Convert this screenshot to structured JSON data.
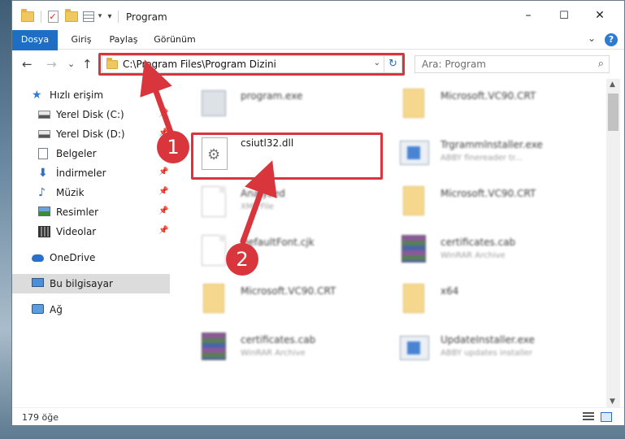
{
  "window": {
    "title": "Program",
    "controls": {
      "minimize": "–",
      "maximize": "☐",
      "close": "✕"
    }
  },
  "ribbon": {
    "tabs": [
      {
        "label": "Dosya",
        "active": true
      },
      {
        "label": "Giriş"
      },
      {
        "label": "Paylaş"
      },
      {
        "label": "Görünüm"
      }
    ],
    "expand_glyph": "⌄",
    "help_glyph": "?"
  },
  "navigation": {
    "back": "←",
    "forward": "→",
    "recent": "⌄",
    "up": "↑"
  },
  "address": {
    "path": "C:\\Program Files\\Program Dizini",
    "dropdown_glyph": "⌄",
    "refresh_glyph": "↻"
  },
  "search": {
    "placeholder": "Ara: Program",
    "icon_glyph": "⌕"
  },
  "sidebar": {
    "items": [
      {
        "label": "Hızlı erişim",
        "icon": "star-icon"
      },
      {
        "label": "Yerel Disk (C:)",
        "icon": "drive-icon",
        "pinned": true
      },
      {
        "label": "Yerel Disk (D:)",
        "icon": "drive-icon",
        "pinned": true
      },
      {
        "label": "Belgeler",
        "icon": "documents-icon",
        "pinned": true
      },
      {
        "label": "İndirmeler",
        "icon": "download-icon",
        "pinned": true
      },
      {
        "label": "Müzik",
        "icon": "music-icon",
        "pinned": true
      },
      {
        "label": "Resimler",
        "icon": "pictures-icon",
        "pinned": true
      },
      {
        "label": "Videolar",
        "icon": "videos-icon",
        "pinned": true
      },
      {
        "label": "OneDrive",
        "icon": "cloud-icon"
      },
      {
        "label": "Bu bilgisayar",
        "icon": "computer-icon",
        "selected": true
      },
      {
        "label": "Ağ",
        "icon": "network-icon"
      }
    ],
    "pin_glyph": "📌"
  },
  "files": [
    {
      "name": "program.exe",
      "sub": "",
      "icon": "exe-icon",
      "blurred": true
    },
    {
      "name": "Microsoft.VC90.CRT",
      "sub": "",
      "icon": "folder-icon",
      "blurred": true
    },
    {
      "name": "csiutl32.dll",
      "sub": "",
      "icon": "dll-gear-icon",
      "blurred": false,
      "highlighted": true
    },
    {
      "name": "Trgrammlnstaller.exe",
      "sub": "ABBY finereader tr...",
      "icon": "installer-icon",
      "blurred": true
    },
    {
      "name": "Analyzed",
      "sub": "XML File",
      "icon": "document-icon",
      "blurred": true
    },
    {
      "name": "Microsoft.VC90.CRT",
      "sub": "",
      "icon": "folder-icon",
      "blurred": true
    },
    {
      "name": "DefaultFont.cjk",
      "sub": "",
      "icon": "document-icon",
      "blurred": true
    },
    {
      "name": "certificates.cab",
      "sub": "WinRAR Archive",
      "icon": "archive-icon",
      "blurred": true
    },
    {
      "name": "Microsoft.VC90.CRT",
      "sub": "",
      "icon": "folder-icon",
      "blurred": true
    },
    {
      "name": "x64",
      "sub": "",
      "icon": "folder-icon",
      "blurred": true
    },
    {
      "name": "certificates.cab",
      "sub": "WinRAR Archive",
      "icon": "archive-icon",
      "blurred": true
    },
    {
      "name": "UpdateInstaller.exe",
      "sub": "ABBY updates installer",
      "icon": "installer-icon",
      "blurred": true
    }
  ],
  "status": {
    "item_count": "179 öğe"
  },
  "annotations": {
    "step1": "1",
    "step2": "2",
    "color": "#d9353c"
  }
}
